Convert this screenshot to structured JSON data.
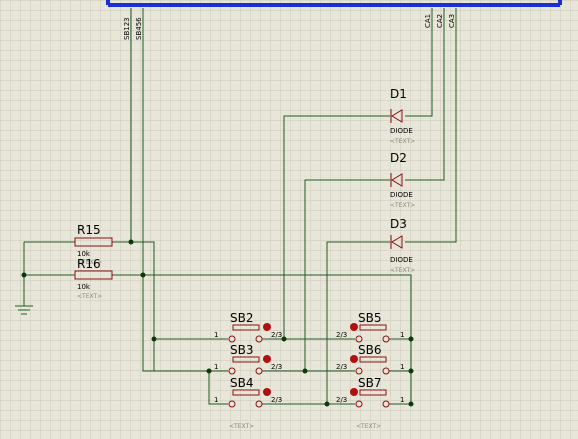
{
  "colors": {
    "background": "#e8e6d8",
    "grid": "#c9c8bb",
    "wire": "#1f5a1f",
    "bus": "#1a2fd4",
    "component": "#8a1010",
    "junction": "#0a3a0a"
  },
  "net_labels": {
    "sb123": "SB123",
    "sb456": "SB456",
    "ca1": "CA1",
    "ca2": "CA2",
    "ca3": "CA3"
  },
  "diodes": [
    {
      "ref": "D1",
      "value": "DIODE",
      "text": "<TEXT>"
    },
    {
      "ref": "D2",
      "value": "DIODE",
      "text": "<TEXT>"
    },
    {
      "ref": "D3",
      "value": "DIODE",
      "text": "<TEXT>"
    }
  ],
  "resistors": [
    {
      "ref": "R15",
      "value": "10k",
      "text": "<TEXT>"
    },
    {
      "ref": "R16",
      "value": "10k",
      "text": "<TEXT>"
    }
  ],
  "buttons_left": [
    {
      "ref": "SB2",
      "pin_left": "1",
      "pin_right": "2/3"
    },
    {
      "ref": "SB3",
      "pin_left": "1",
      "pin_right": "2/3"
    },
    {
      "ref": "SB4",
      "pin_left": "1",
      "pin_right": "2/3"
    }
  ],
  "buttons_right": [
    {
      "ref": "SB5",
      "pin_left": "2/3",
      "pin_right": "1"
    },
    {
      "ref": "SB6",
      "pin_left": "2/3",
      "pin_right": "1"
    },
    {
      "ref": "SB7",
      "pin_left": "2/3",
      "pin_right": "1"
    }
  ],
  "bottom_text": {
    "left": "<TEXT>",
    "right": "<TEXT>"
  }
}
